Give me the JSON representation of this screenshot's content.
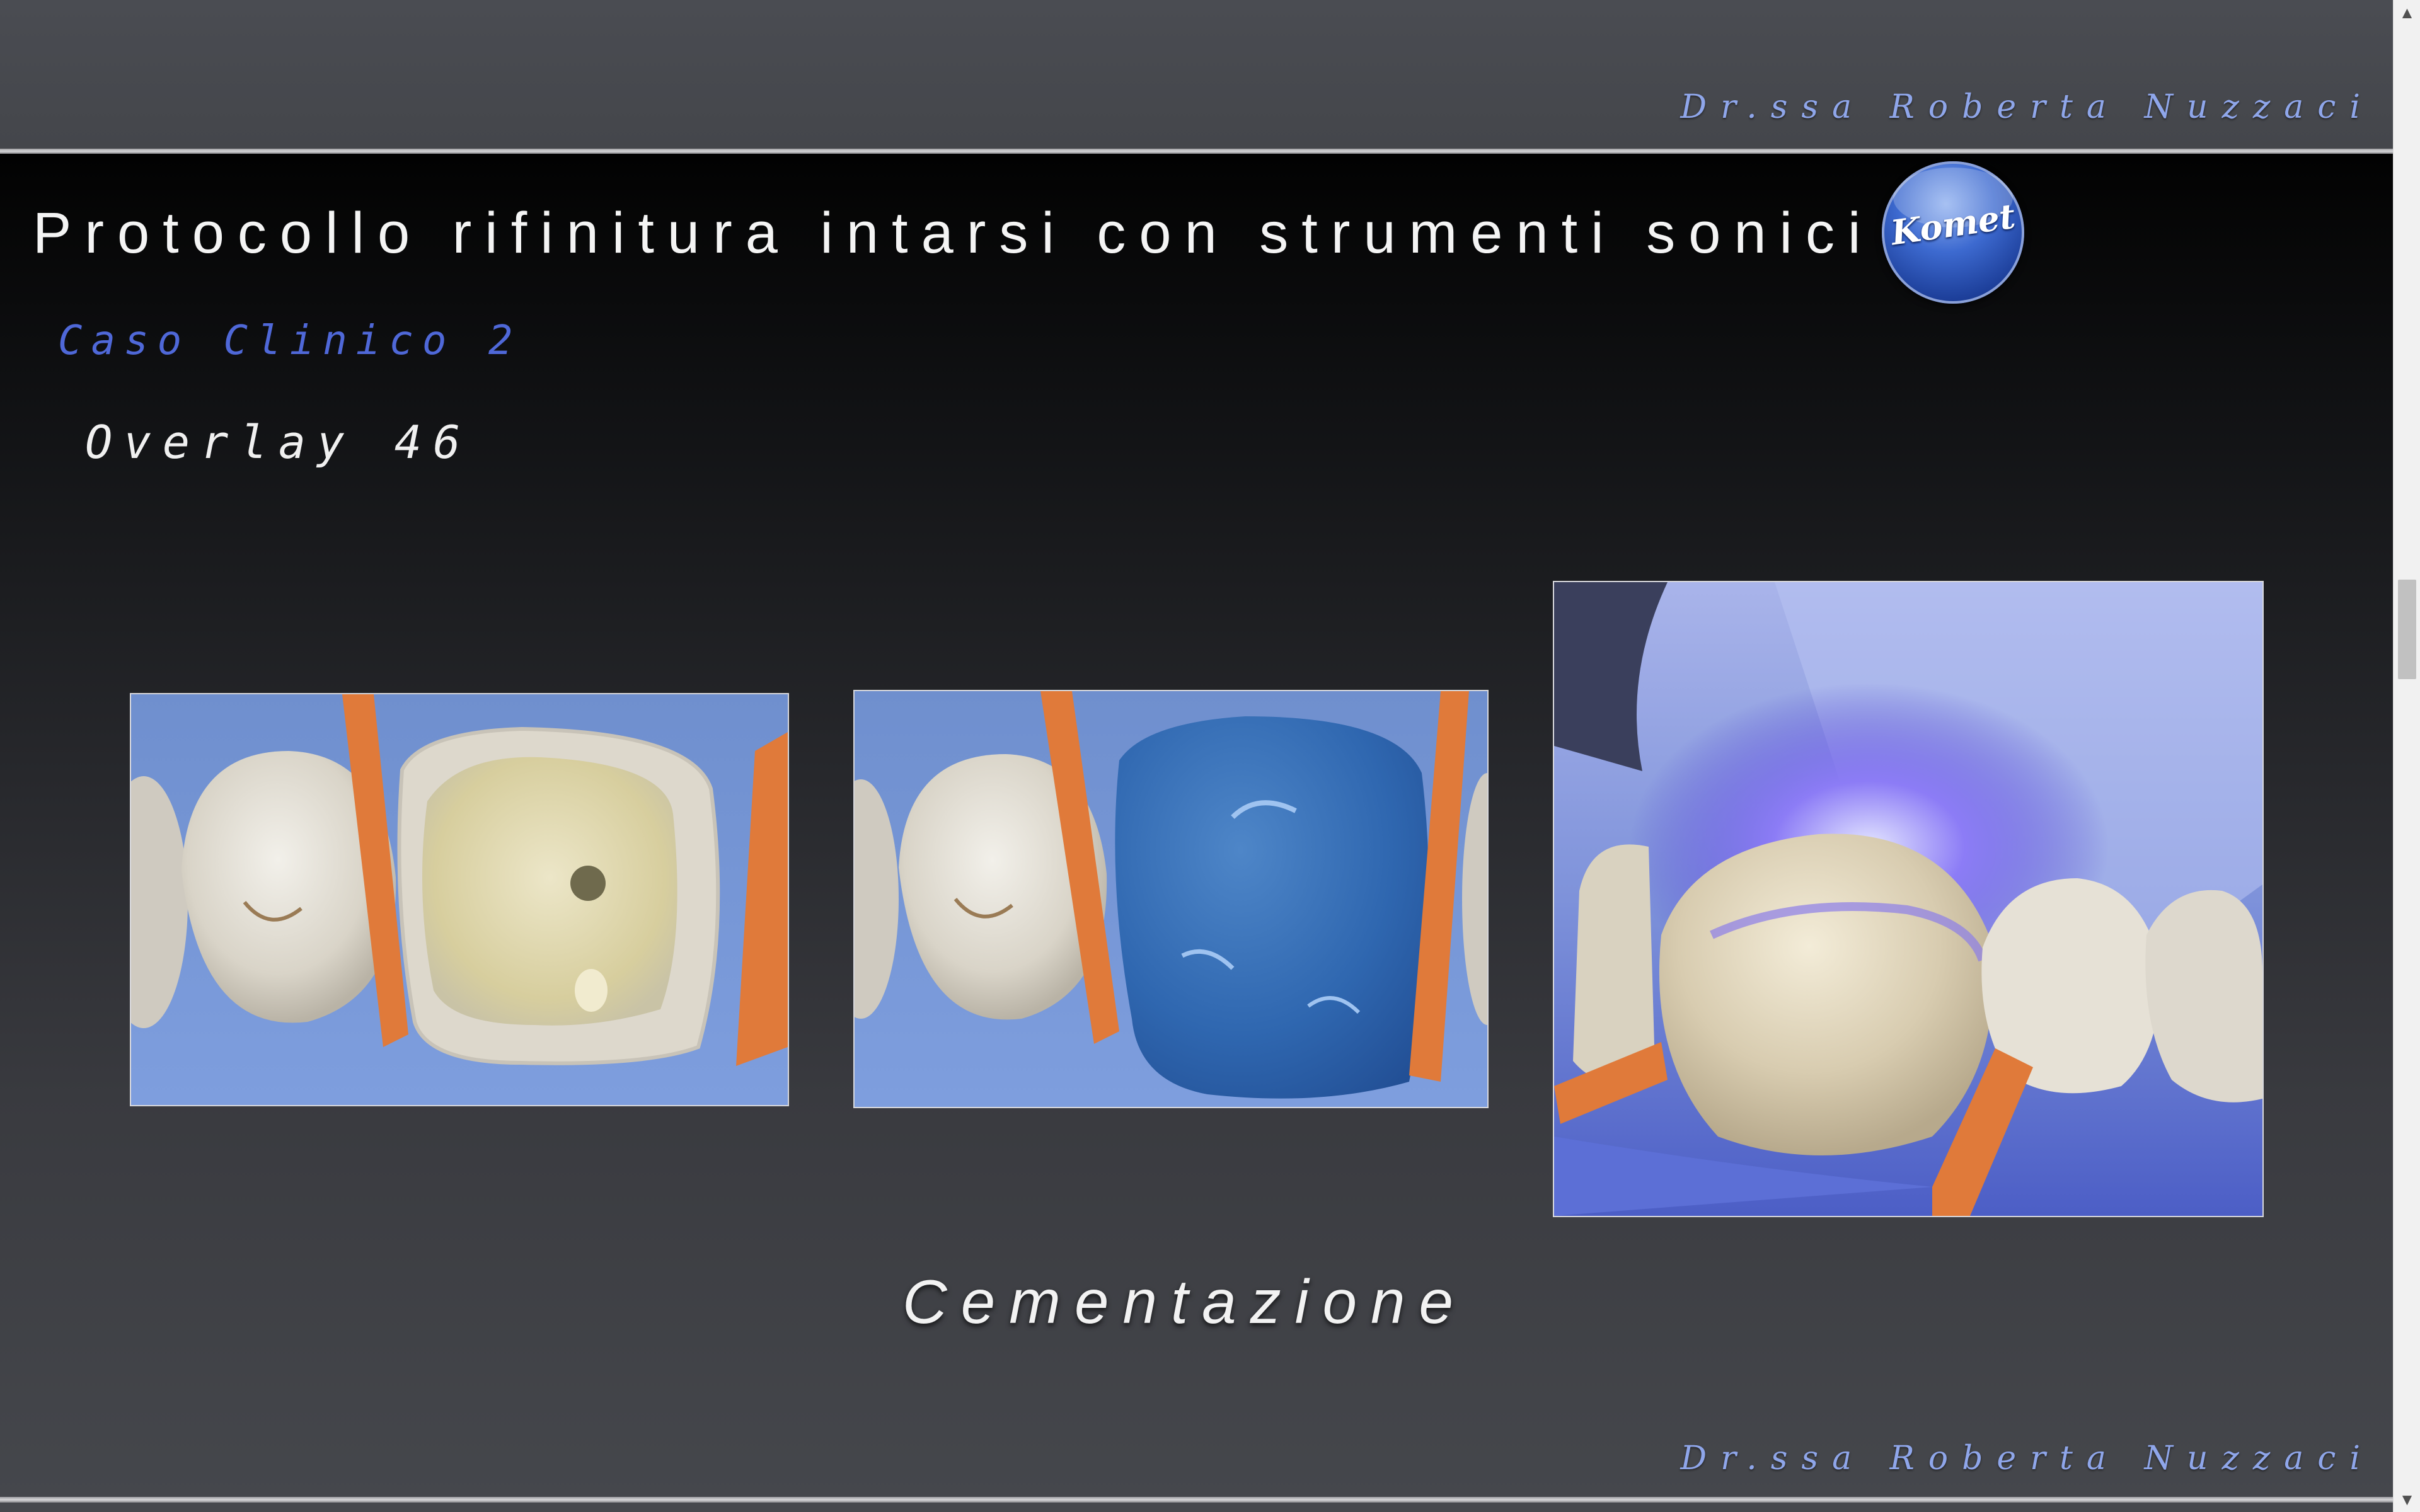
{
  "header": {
    "signature": "Dr.ssa Roberta Nuzzaci"
  },
  "slide": {
    "title": "Protocollo rifinitura intarsi con strumenti sonici",
    "logo_text": "Komet",
    "subtitle": "Caso Clinico 2",
    "case_label": "Overlay 46",
    "caption": "Cementazione",
    "photos": [
      "photo-prepared-tooth",
      "photo-blue-gel-applied",
      "photo-light-curing"
    ]
  },
  "footer": {
    "signature": "Dr.ssa Roberta Nuzzaci"
  },
  "scrollbar": {
    "up_icon": "chevron-up-icon",
    "down_icon": "chevron-down-icon"
  },
  "colors": {
    "signature": "#8fa6ea",
    "subtitle": "#4f68d8",
    "title": "#f4f4f4",
    "logo": "#2f5cc4"
  }
}
